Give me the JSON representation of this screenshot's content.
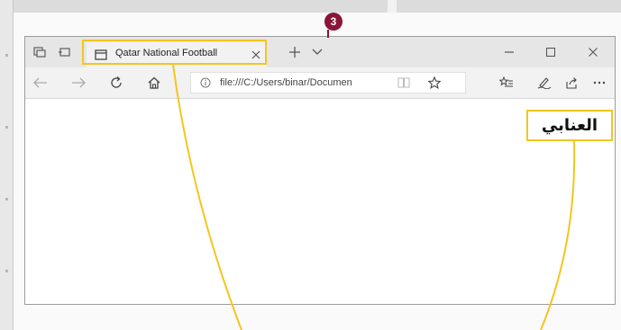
{
  "callout": {
    "step_number": "3"
  },
  "browser": {
    "tab": {
      "title": "Qatar National Football"
    },
    "address_bar": {
      "url": "file:///C:/Users/binar/Documen"
    },
    "icons": {
      "set_aside_tabs": "tabs-aside-icon",
      "show_tabs": "tab-preview-icon",
      "tab_page": "page-icon",
      "close_tab": "close-icon",
      "new_tab": "plus-icon",
      "tab_list": "chevron-down-icon",
      "minimize": "minimize-icon",
      "maximize": "maximize-icon",
      "close_window": "close-window-icon",
      "back": "back-arrow-icon",
      "forward": "forward-arrow-icon",
      "refresh": "refresh-icon",
      "home": "home-icon",
      "site_info": "info-icon",
      "reading_view": "reading-view-icon",
      "favorite": "star-icon",
      "favorites_hub": "favorites-list-icon",
      "web_note": "pen-icon",
      "share": "share-icon",
      "more": "more-icon"
    }
  },
  "page": {
    "heading": "العنابي"
  },
  "colors": {
    "highlight": "#f4c51f",
    "badge": "#8a1538"
  }
}
